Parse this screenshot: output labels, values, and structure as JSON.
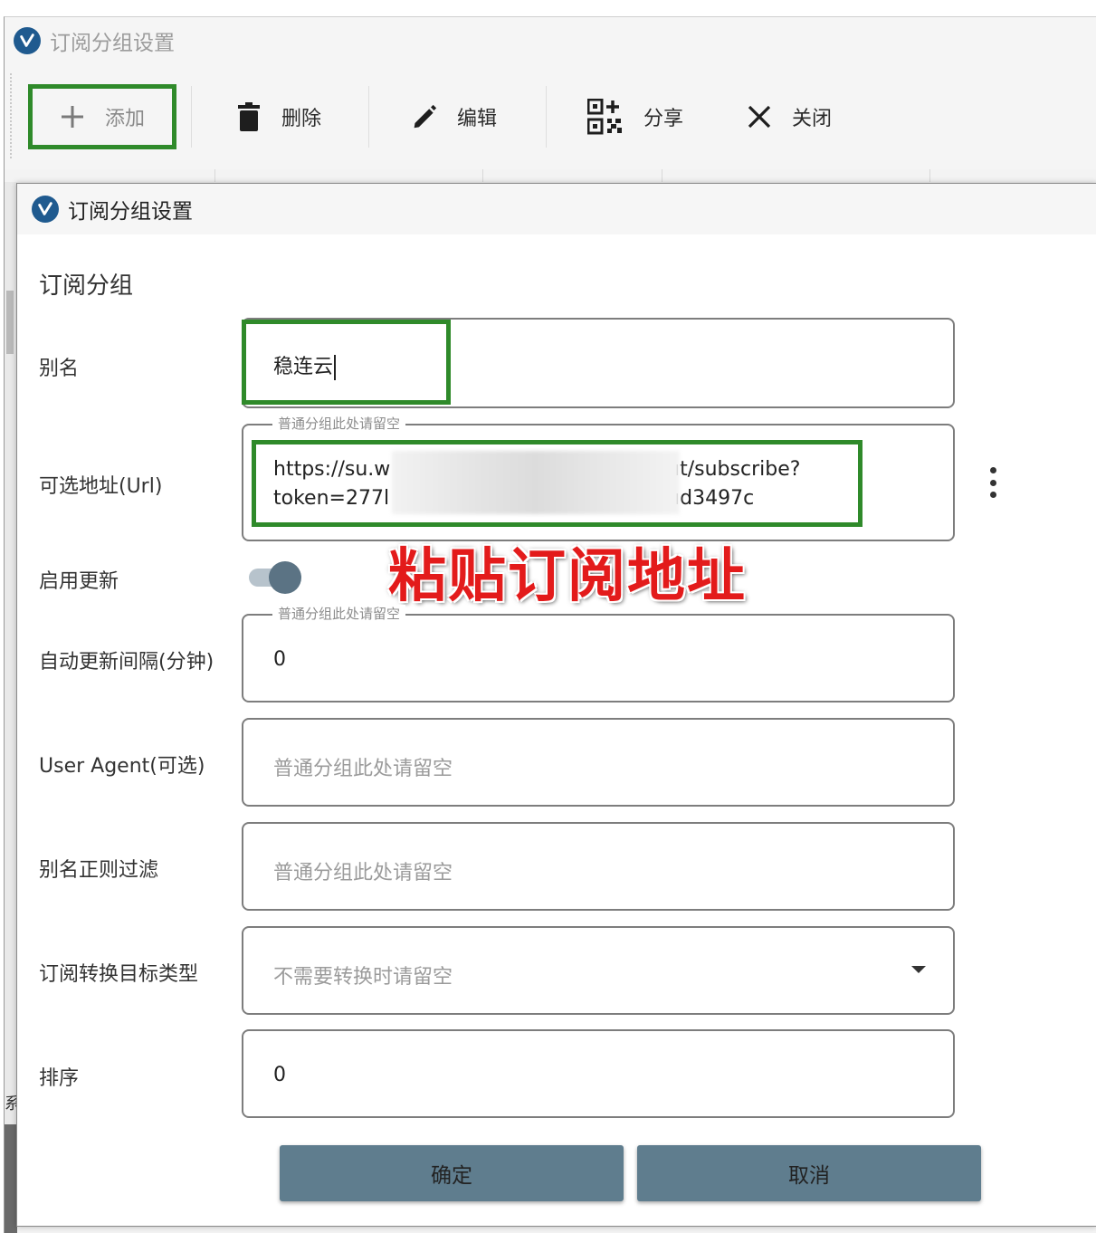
{
  "outer_window": {
    "title": "订阅分组设置",
    "toolbar": {
      "add_label": "添加",
      "delete_label": "删除",
      "edit_label": "编辑",
      "share_label": "分享",
      "close_label": "关闭"
    },
    "side_glyph": "系"
  },
  "dialog": {
    "title": "订阅分组设置",
    "section_title": "订阅分组",
    "fields": {
      "alias": {
        "label": "别名",
        "value": "稳连云"
      },
      "url": {
        "label": "可选地址(Url)",
        "legend": "普通分组此处请留空",
        "line1_start": "https://su.w",
        "line1_end": "ıt/subscribe?",
        "line2_start": "token=277l",
        "line2_end": "ıd3497c"
      },
      "enable_update": {
        "label": "启用更新",
        "enabled": true
      },
      "update_interval": {
        "label": "自动更新间隔(分钟)",
        "legend": "普通分组此处请留空",
        "value": "0"
      },
      "user_agent": {
        "label": "User Agent(可选)",
        "placeholder": "普通分组此处请留空"
      },
      "alias_filter": {
        "label": "别名正则过滤",
        "placeholder": "普通分组此处请留空"
      },
      "convert_target": {
        "label": "订阅转换目标类型",
        "placeholder": "不需要转换时请留空"
      },
      "sort": {
        "label": "排序",
        "value": "0"
      }
    },
    "annotation": "粘贴订阅地址",
    "buttons": {
      "ok": "确定",
      "cancel": "取消"
    }
  },
  "colors": {
    "highlight_green": "#2f8a2a",
    "annotation_red": "#e31b1b",
    "button_bg": "#5f7d8e",
    "toggle_knob": "#5b7384",
    "logo_blue": "#1f5a8f"
  },
  "icons": [
    "app-logo-icon",
    "plus-icon",
    "trash-icon",
    "pencil-icon",
    "qr-add-icon",
    "close-x-icon",
    "more-vert-icon",
    "dropdown-arrow-icon"
  ]
}
